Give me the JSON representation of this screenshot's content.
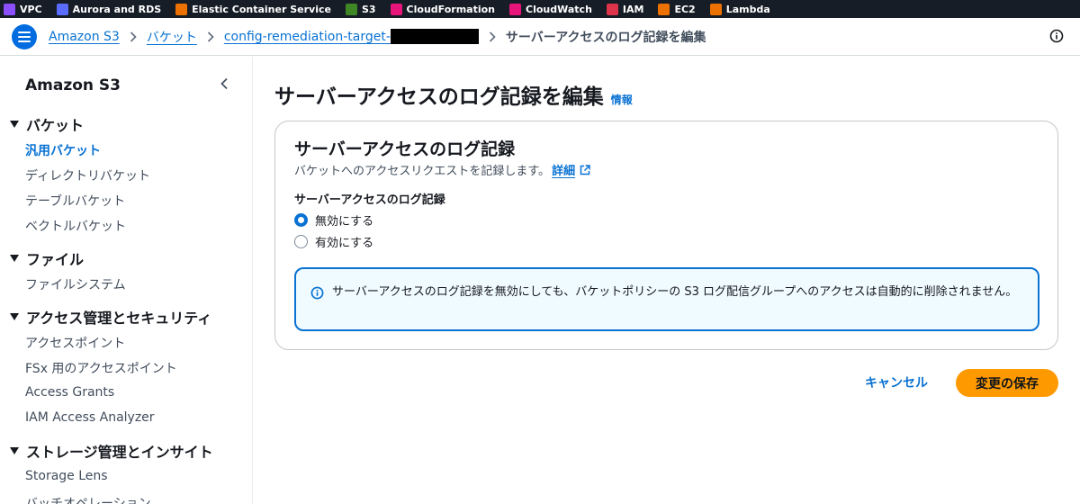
{
  "favorites": [
    {
      "label": "VPC",
      "icon": "vpc-icon",
      "color": "#8c4fff"
    },
    {
      "label": "Aurora and RDS",
      "icon": "rds-icon",
      "color": "#5a6bff"
    },
    {
      "label": "Elastic Container Service",
      "icon": "ecs-icon",
      "color": "#ed7100"
    },
    {
      "label": "S3",
      "icon": "s3-icon",
      "color": "#3f8624"
    },
    {
      "label": "CloudFormation",
      "icon": "cloudformation-icon",
      "color": "#e7157b"
    },
    {
      "label": "CloudWatch",
      "icon": "cloudwatch-icon",
      "color": "#e7157b"
    },
    {
      "label": "IAM",
      "icon": "iam-icon",
      "color": "#dd344c"
    },
    {
      "label": "EC2",
      "icon": "ec2-icon",
      "color": "#ed7100"
    },
    {
      "label": "Lambda",
      "icon": "lambda-icon",
      "color": "#ed7100"
    }
  ],
  "breadcrumb": {
    "s3": "Amazon S3",
    "buckets": "バケット",
    "bucket_name": "config-remediation-target-",
    "current": "サーバーアクセスのログ記録を編集"
  },
  "sidebar": {
    "title": "Amazon S3",
    "sections": [
      {
        "label": "バケット",
        "items": [
          "汎用バケット",
          "ディレクトリバケット",
          "テーブルバケット",
          "ベクトルバケット"
        ]
      },
      {
        "label": "ファイル",
        "items": [
          "ファイルシステム"
        ]
      },
      {
        "label": "アクセス管理とセキュリティ",
        "items": [
          "アクセスポイント",
          "FSx 用のアクセスポイント",
          "Access Grants",
          "IAM Access Analyzer"
        ]
      },
      {
        "label": "ストレージ管理とインサイト",
        "items": [
          "Storage Lens",
          "バッチオペレーション"
        ]
      }
    ],
    "active_item": "汎用バケット"
  },
  "page": {
    "title": "サーバーアクセスのログ記録を編集",
    "info": "情報"
  },
  "panel": {
    "title": "サーバーアクセスのログ記録",
    "description": "バケットへのアクセスリクエストを記録します。",
    "detail_link": "詳細",
    "field_label": "サーバーアクセスのログ記録",
    "options": [
      "無効にする",
      "有効にする"
    ],
    "selected": "無効にする",
    "alert": "サーバーアクセスのログ記録を無効にしても、バケットポリシーの S3 ログ配信グループへのアクセスは自動的に削除されません。"
  },
  "actions": {
    "cancel": "キャンセル",
    "save": "変更の保存"
  },
  "colors": {
    "link": "#0972d3",
    "primary_button": "#ff9900",
    "alert_bg": "#f0fbff"
  }
}
